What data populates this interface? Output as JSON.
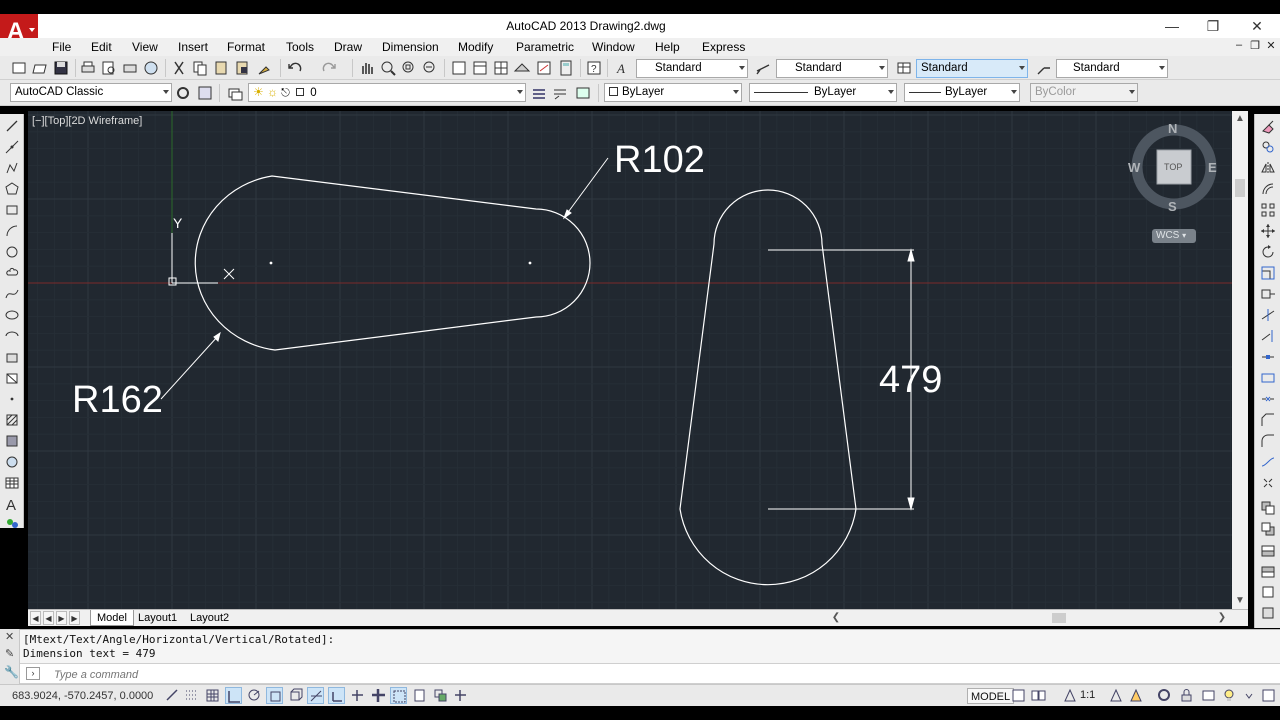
{
  "window": {
    "title": "AutoCAD 2013    Drawing2.dwg"
  },
  "menu": [
    "File",
    "Edit",
    "View",
    "Insert",
    "Format",
    "Tools",
    "Draw",
    "Dimension",
    "Modify",
    "Parametric",
    "Window",
    "Help",
    "Express"
  ],
  "toolbar_styles": {
    "text_style": "Standard",
    "dim_style": "Standard",
    "table_style": "Standard",
    "mleader_style": "Standard"
  },
  "toolbar_layers": {
    "workspace": "AutoCAD Classic",
    "layer": "0",
    "color": "ByLayer",
    "linetype": "ByLayer",
    "lineweight": "ByLayer",
    "plotstyle": "ByColor"
  },
  "viewport": {
    "label": "[−][Top][2D Wireframe]"
  },
  "viewcube": {
    "n": "N",
    "s": "S",
    "e": "E",
    "w": "W",
    "face": "TOP",
    "wcs": "WCS"
  },
  "drawing": {
    "label_r102": "R102",
    "label_r162": "R162",
    "dim_value": "479",
    "ucs_y": "Y"
  },
  "layout_tabs": [
    "Model",
    "Layout1",
    "Layout2"
  ],
  "command": {
    "history": [
      "[Mtext/Text/Angle/Horizontal/Vertical/Rotated]:",
      "Dimension text = 479"
    ],
    "placeholder": "Type a command"
  },
  "status": {
    "coords": "683.9024, -570.2457, 0.0000",
    "model": "MODEL",
    "scale": "1:1"
  },
  "colors": {
    "canvas_bg": "#212830",
    "grid_minor": "#262e36",
    "grid_major": "#2f3841",
    "geometry": "#ffffff",
    "x_axis": "#7a2a2a",
    "y_axis": "#2a6a2a",
    "logo": "#c41a1a"
  }
}
